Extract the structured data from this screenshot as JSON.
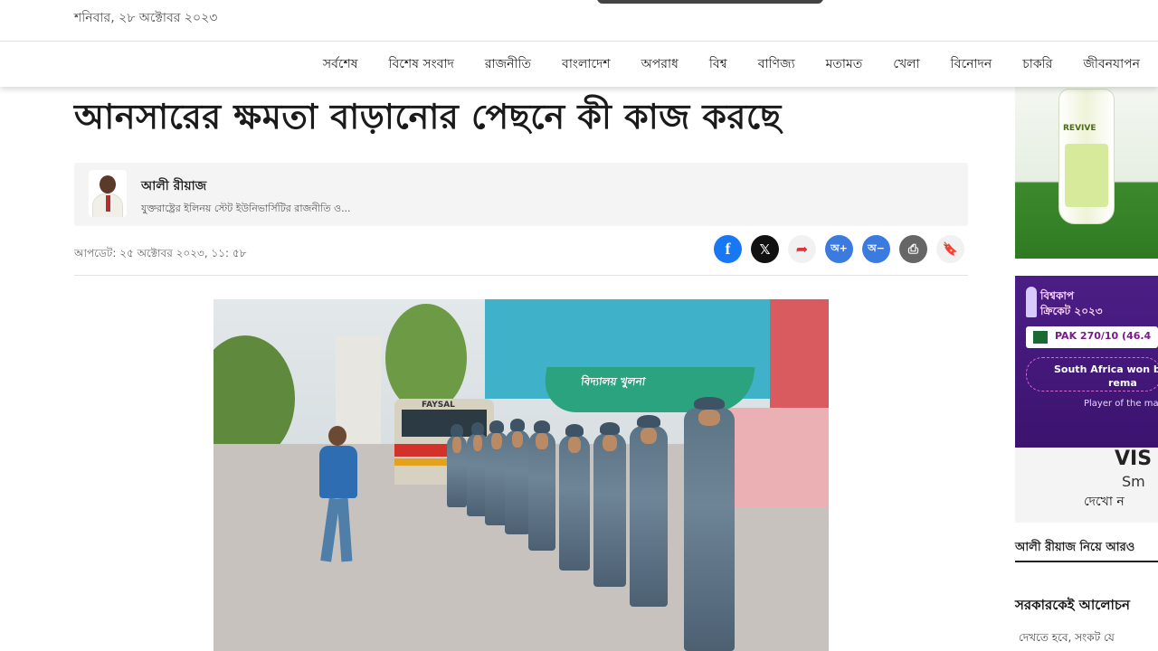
{
  "header": {
    "date": "শনিবার, ২৮ অক্টোবর ২০২৩"
  },
  "nav": {
    "items": [
      "সর্বশেষ",
      "বিশেষ সংবাদ",
      "রাজনীতি",
      "বাংলাদেশ",
      "অপরাধ",
      "বিশ্ব",
      "বাণিজ্য",
      "মতামত",
      "খেলা",
      "বিনোদন",
      "চাকরি",
      "জীবনযাপন"
    ]
  },
  "article": {
    "headline": "আনসারের ক্ষমতা বাড়ানোর পেছনে কী কাজ করছে",
    "author": {
      "name": "আলী রীয়াজ",
      "description": "যুক্তরাষ্ট্রের ইলিনয় স্টেট ইউনিভার্সিটির রাজনীতি ও..."
    },
    "updated": "আপডেট: ২৫ অক্টোবর ২০২৩, ১১: ৫৮",
    "share_buttons": [
      {
        "icon": "facebook-icon",
        "glyph": "f"
      },
      {
        "icon": "x-icon",
        "glyph": "𝕏"
      },
      {
        "icon": "share-icon",
        "glyph": "➦"
      },
      {
        "icon": "font-increase-icon",
        "glyph": "অ+"
      },
      {
        "icon": "font-decrease-icon",
        "glyph": "অ−"
      },
      {
        "icon": "print-icon",
        "glyph": "⎙"
      },
      {
        "icon": "bookmark-icon",
        "glyph": "🔖"
      }
    ],
    "bus_text": "FAYSAL",
    "sign_text": "বিদ্যালয় খুলনা"
  },
  "sidebar": {
    "ad1": {
      "brand": "REVIVE"
    },
    "ad2": {
      "title_line1": "বিশ্বকাপ",
      "title_line2": "ক্রিকেট ২০২৩",
      "score": "PAK 270/10 (46.4",
      "result_line1": "South Africa won by",
      "result_line2": "rema",
      "player_of_match": "Player of the ma",
      "visa": "VIS",
      "visa_sub": "Sm",
      "visa_bn": "দেখো ন"
    },
    "more_by": "আলী রীয়াজ নিয়ে আরও",
    "related_title": "সরকারকেই আলোচন",
    "related_sub": "দেখতে হবে, সংকট যে"
  }
}
